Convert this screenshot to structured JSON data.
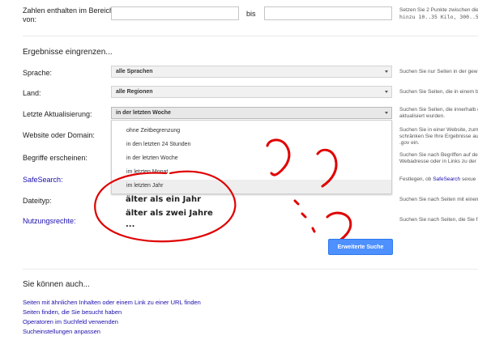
{
  "range": {
    "label_line1": "Zahlen enthalten im Bereich",
    "label_line2": "von:",
    "bis": "bis",
    "help_line1": "Setzen Sie 2 Punkte zwischen die",
    "help_line2": "hinzu 10..35 Kilo, 300..500"
  },
  "narrow": {
    "title": "Ergebnisse eingrenzen..."
  },
  "rows": {
    "sprache": {
      "label": "Sprache:",
      "value": "alle Sprachen",
      "help": "Suchen Sie nur Seiten in der gew"
    },
    "land": {
      "label": "Land:",
      "value": "alle Regionen",
      "help": "Suchen Sie Seiten, die in einem b"
    },
    "aktualisierung": {
      "label": "Letzte Aktualisierung:",
      "value": "in der letzten Woche",
      "help_line1": "Suchen Sie Seiten, die innerhalb d",
      "help_line2": "aktualisiert wurden."
    },
    "website": {
      "label": "Website oder Domain:",
      "help_line1": "Suchen Sie in einer Website, zum",
      "help_line2": "schränken Sie Ihre Ergebnisse au",
      "help_line3": ".gov ein."
    },
    "begriffe": {
      "label": "Begriffe erscheinen:",
      "help_line1": "Suchen Sie nach Begriffen auf de",
      "help_line2": "Webadresse oder in Links zu der"
    },
    "safesearch": {
      "label": "SafeSearch:",
      "help_pre": "Festlegen, ob ",
      "help_link": "SafeSearch",
      "help_post": " sexue"
    },
    "dateityp": {
      "label": "Dateityp:",
      "help": "Suchen Sie nach Seiten mit einem"
    },
    "nutzungsrechte": {
      "label": "Nutzungsrechte:",
      "help": "Suchen Sie nach Seiten, die Sie fr"
    }
  },
  "dropdown": {
    "options": [
      "ohne Zeitbegrenzung",
      "in den letzten 24 Stunden",
      "in der letzten Woche",
      "im letzten Monat",
      "im letzten Jahr"
    ],
    "highlighted_index": 4
  },
  "handwritten": [
    "älter als ein Jahr",
    "älter als zwei Jahre",
    "..."
  ],
  "button": {
    "label": "Erweiterte Suche"
  },
  "also": {
    "title": "Sie können auch...",
    "links": [
      "Seiten mit ähnlichen Inhalten oder einem Link zu einer URL finden",
      "Seiten finden, die Sie besucht haben",
      "Operatoren im Suchfeld verwenden",
      "Sucheinstellungen anpassen"
    ]
  },
  "colors": {
    "link": "#1a0dab",
    "button": "#4d90fe",
    "annotation": "#e00000"
  }
}
